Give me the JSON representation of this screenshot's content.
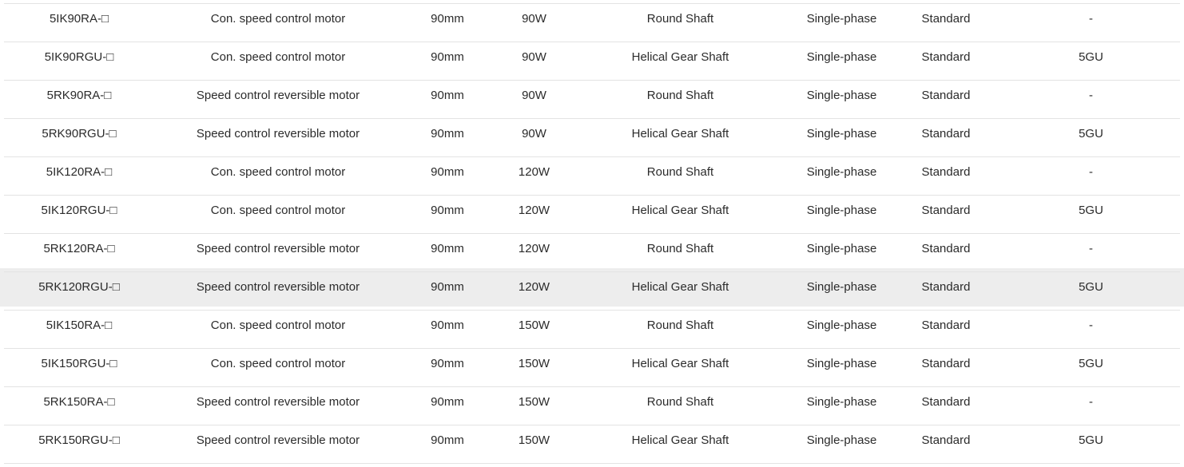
{
  "table": {
    "name": "motor-specification-table",
    "columns": [
      {
        "key": "model",
        "align": "center"
      },
      {
        "key": "type",
        "align": "center"
      },
      {
        "key": "size",
        "align": "center"
      },
      {
        "key": "output",
        "align": "center"
      },
      {
        "key": "shaft",
        "align": "center"
      },
      {
        "key": "phase",
        "align": "center"
      },
      {
        "key": "grade",
        "align": "center"
      },
      {
        "key": "gearhead",
        "align": "center"
      }
    ],
    "highlight_color": "#ededed",
    "rule_color": "#e3e3e3",
    "text_color": "#2b2b2b",
    "rows": [
      {
        "highlighted": false,
        "model": "5IK90RA-□",
        "type": "Con. speed control motor",
        "size": "90mm",
        "output": "90W",
        "shaft": "Round Shaft",
        "phase": "Single-phase",
        "grade": "Standard",
        "gearhead": "-"
      },
      {
        "highlighted": false,
        "model": "5IK90RGU-□",
        "type": "Con. speed control motor",
        "size": "90mm",
        "output": "90W",
        "shaft": "Helical Gear Shaft",
        "phase": "Single-phase",
        "grade": "Standard",
        "gearhead": "5GU"
      },
      {
        "highlighted": false,
        "model": "5RK90RA-□",
        "type": "Speed control reversible motor",
        "size": "90mm",
        "output": "90W",
        "shaft": "Round Shaft",
        "phase": "Single-phase",
        "grade": "Standard",
        "gearhead": "-"
      },
      {
        "highlighted": false,
        "model": "5RK90RGU-□",
        "type": "Speed control reversible motor",
        "size": "90mm",
        "output": "90W",
        "shaft": "Helical Gear Shaft",
        "phase": "Single-phase",
        "grade": "Standard",
        "gearhead": "5GU"
      },
      {
        "highlighted": false,
        "model": "5IK120RA-□",
        "type": "Con. speed control motor",
        "size": "90mm",
        "output": "120W",
        "shaft": "Round Shaft",
        "phase": "Single-phase",
        "grade": "Standard",
        "gearhead": "-"
      },
      {
        "highlighted": false,
        "model": "5IK120RGU-□",
        "type": "Con. speed control motor",
        "size": "90mm",
        "output": "120W",
        "shaft": "Helical Gear Shaft",
        "phase": "Single-phase",
        "grade": "Standard",
        "gearhead": "5GU"
      },
      {
        "highlighted": false,
        "model": "5RK120RA-□",
        "type": "Speed control reversible motor",
        "size": "90mm",
        "output": "120W",
        "shaft": "Round Shaft",
        "phase": "Single-phase",
        "grade": "Standard",
        "gearhead": "-"
      },
      {
        "highlighted": true,
        "model": "5RK120RGU-□",
        "type": "Speed control reversible motor",
        "size": "90mm",
        "output": "120W",
        "shaft": "Helical Gear Shaft",
        "phase": "Single-phase",
        "grade": "Standard",
        "gearhead": "5GU"
      },
      {
        "highlighted": false,
        "model": "5IK150RA-□",
        "type": "Con. speed control motor",
        "size": "90mm",
        "output": "150W",
        "shaft": "Round Shaft",
        "phase": "Single-phase",
        "grade": "Standard",
        "gearhead": "-"
      },
      {
        "highlighted": false,
        "model": "5IK150RGU-□",
        "type": "Con. speed control motor",
        "size": "90mm",
        "output": "150W",
        "shaft": "Helical Gear Shaft",
        "phase": "Single-phase",
        "grade": "Standard",
        "gearhead": "5GU"
      },
      {
        "highlighted": false,
        "model": "5RK150RA-□",
        "type": "Speed control reversible motor",
        "size": "90mm",
        "output": "150W",
        "shaft": "Round Shaft",
        "phase": "Single-phase",
        "grade": "Standard",
        "gearhead": "-"
      },
      {
        "highlighted": false,
        "model": "5RK150RGU-□",
        "type": "Speed control reversible motor",
        "size": "90mm",
        "output": "150W",
        "shaft": "Helical Gear Shaft",
        "phase": "Single-phase",
        "grade": "Standard",
        "gearhead": "5GU"
      }
    ]
  }
}
